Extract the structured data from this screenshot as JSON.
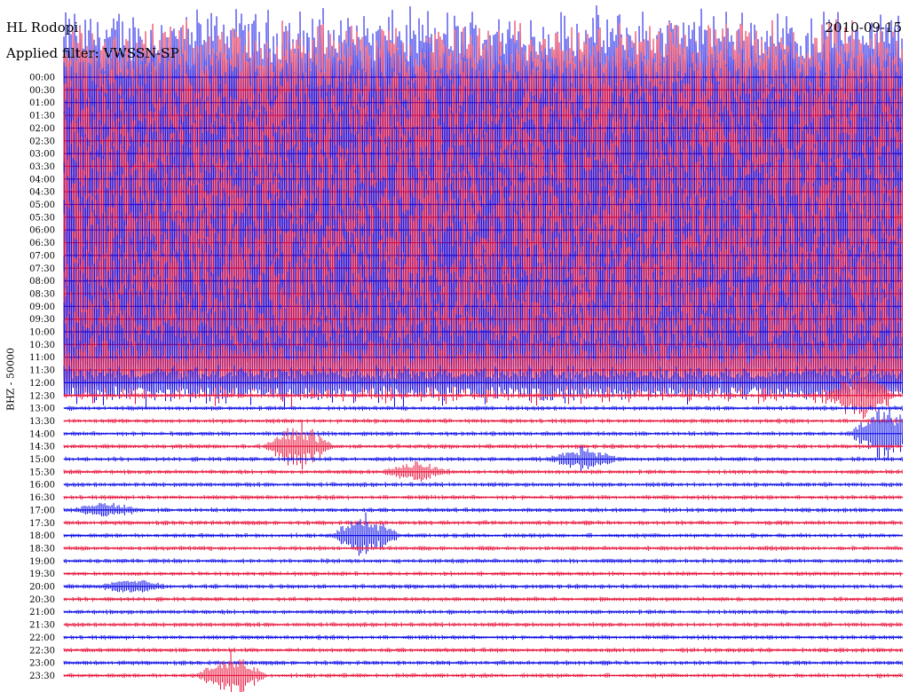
{
  "header": {
    "station": "HL Rodopi",
    "filter": "Applied filter: VWSSN-SP",
    "date": "2010-09-15"
  },
  "ylabel": "BHZ - 50000",
  "colors": {
    "odd": "#e8123a",
    "even": "#0a0ae6"
  },
  "chart_data": {
    "type": "line",
    "title": "HL Rodopi",
    "ylabel": "BHZ - 50000",
    "row_labels": [
      "00:00",
      "00:30",
      "01:00",
      "01:30",
      "02:00",
      "02:30",
      "03:00",
      "03:30",
      "04:00",
      "04:30",
      "05:00",
      "05:30",
      "06:00",
      "06:30",
      "07:00",
      "07:30",
      "08:00",
      "08:30",
      "09:00",
      "09:30",
      "10:00",
      "10:30",
      "11:00",
      "11:30",
      "12:00",
      "12:30",
      "13:00",
      "13:30",
      "14:00",
      "14:30",
      "15:00",
      "15:30",
      "16:00",
      "16:30",
      "17:00",
      "17:30",
      "18:00",
      "18:30",
      "19:00",
      "19:30",
      "20:00",
      "20:30",
      "21:00",
      "21:30",
      "22:00",
      "22:30",
      "23:00",
      "23:30"
    ],
    "noise_level": [
      1.0,
      1.0,
      1.0,
      1.0,
      1.0,
      1.0,
      1.0,
      1.0,
      1.0,
      1.0,
      1.0,
      1.0,
      1.0,
      1.0,
      1.0,
      1.0,
      1.0,
      1.0,
      1.0,
      1.0,
      0.9,
      0.8,
      0.7,
      0.5,
      0.25,
      0.05,
      0.03,
      0.02,
      0.03,
      0.03,
      0.02,
      0.02,
      0.02,
      0.02,
      0.02,
      0.02,
      0.02,
      0.02,
      0.02,
      0.02,
      0.02,
      0.02,
      0.02,
      0.02,
      0.02,
      0.02,
      0.02,
      0.02
    ],
    "events": [
      {
        "row": 25,
        "x": 0.95,
        "amp": 0.6
      },
      {
        "row": 28,
        "x": 0.98,
        "amp": 0.7
      },
      {
        "row": 29,
        "x": 0.28,
        "amp": 0.5
      },
      {
        "row": 30,
        "x": 0.62,
        "amp": 0.25
      },
      {
        "row": 31,
        "x": 0.42,
        "amp": 0.2
      },
      {
        "row": 34,
        "x": 0.05,
        "amp": 0.15
      },
      {
        "row": 36,
        "x": 0.36,
        "amp": 0.5
      },
      {
        "row": 40,
        "x": 0.08,
        "amp": 0.15
      },
      {
        "row": 47,
        "x": 0.2,
        "amp": 0.5
      }
    ]
  }
}
